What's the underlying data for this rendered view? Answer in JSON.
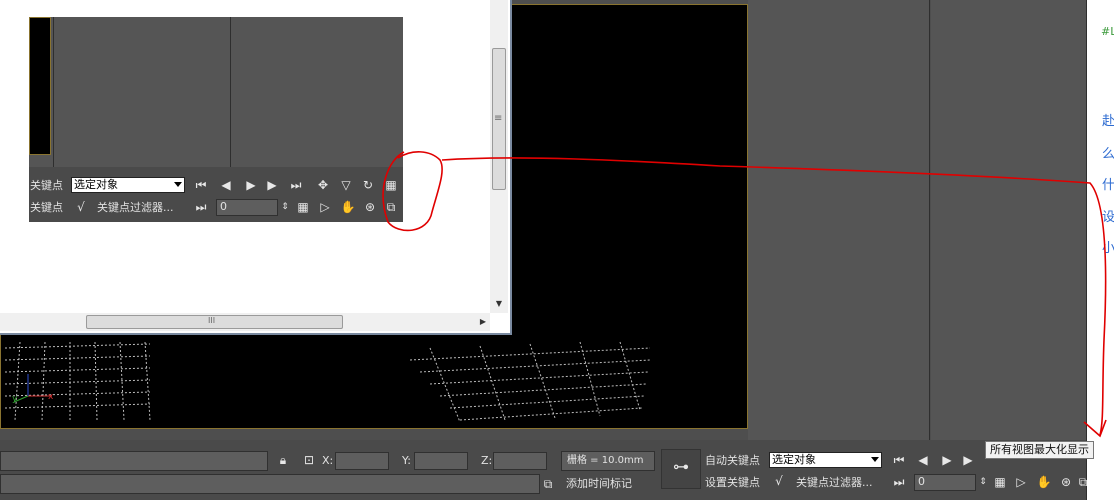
{
  "colors": {
    "annotation": "#e00000",
    "viewport_border": "#8a7430",
    "panel": "#555555"
  },
  "inset_toolbar": {
    "auto_key_label": "关键点",
    "set_key_label": "关键点",
    "selection_dropdown": "选定对象",
    "key_filters_label": "关键点过滤器...",
    "frame_value": "0"
  },
  "status_bar": {
    "x_label": "X:",
    "y_label": "Y:",
    "z_label": "Z:",
    "grid_text": "栅格 = 10.0mm",
    "add_time_tag": "添加时间标记"
  },
  "anim_controls": {
    "auto_key_label": "自动关键点",
    "set_key_label": "设置关键点",
    "selection_dropdown": "选定对象",
    "key_filters_label": "关键点过滤器...",
    "frame_value": "0"
  },
  "tooltip": {
    "text": "所有视图最大化显示"
  },
  "right_edge": {
    "chars": [
      "赴",
      "么",
      "什",
      "设",
      "小"
    ],
    "top_fragment": "#L"
  },
  "scrollbar": {
    "grip": "≡",
    "hgrip": "III"
  },
  "axis_gizmo": {
    "x": "x",
    "y": "y"
  }
}
